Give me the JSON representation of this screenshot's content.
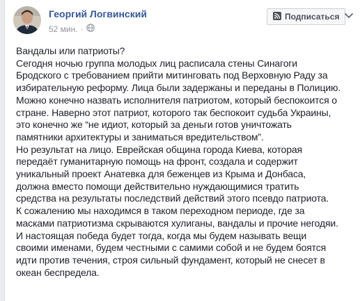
{
  "post": {
    "author": "Георгий Логвинский",
    "timestamp": "52 мин.",
    "privacy_icon": "globe-icon",
    "subscribe_label": "Подписаться",
    "subscribe_icon": "rss-icon",
    "more_icon": "chevron-down-icon",
    "lines": [
      "Вандалы или патриоты?",
      "Сегодня ночью группа молодых лиц расписала стены Синагоги",
      "Бродского с требованием прийти митинговать под Верховную Раду за",
      "избирательную реформу. Лица были задержаны и переданы в Полицию.",
      "Можно конечно назвать исполнителя патриотом, который беспокоится о",
      "стране. Наверно этот патриот, которого так беспокоит судьба Украины,",
      "это конечно же “не идиот, который за деньги готов уничтожать",
      "памятники архитектуры и заниматься вредительством”.",
      "Но результат на лицо. Еврейская община города Киева, которая",
      "передаёт гуманитарную помощь на фронт, создала и содержит",
      "уникальный проект Анатевка для беженцев из Крыма и Донбаса,",
      "должна вместо помощи действительно нуждающимися тратить",
      "средства на результаты последствий действий этого псевдо патриота.",
      "К сожалению мы находимся в таком переходном периоде, где за",
      "масками патриотизма скрываются хулиганы, вандалы и прочие негодяи.",
      "И настоящая победа будет тогда, когда мы будем называть вещи",
      "своими именами, будем честными с самими собой и не будем боятся",
      "идти против течения, строя сильный фундамент, который не снесет в",
      "океан беспредела."
    ]
  },
  "colors": {
    "author_link": "#365899",
    "text": "#1d2129",
    "meta": "#90949c",
    "button_bg": "#f6f7f9",
    "page_bg": "#e9ebee"
  }
}
